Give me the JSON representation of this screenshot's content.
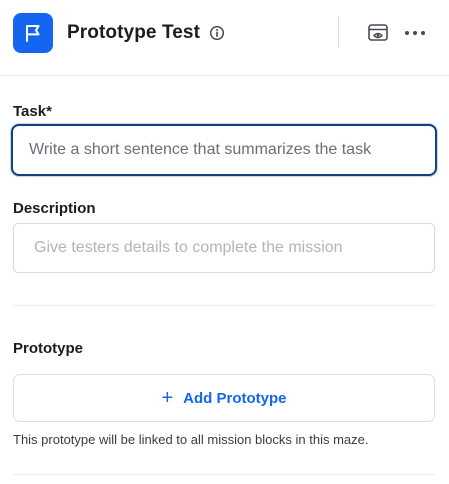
{
  "header": {
    "title": "Prototype Test",
    "icon": "flag-icon",
    "accent_color": "#1466f0",
    "actions": [
      "info-icon",
      "preview-icon",
      "more-icon"
    ]
  },
  "task": {
    "label": "Task*",
    "value": "",
    "placeholder": "Write a short sentence that summarizes the task"
  },
  "description": {
    "label": "Description",
    "value": "",
    "placeholder": "Give testers details to complete the mission"
  },
  "prototype": {
    "label": "Prototype",
    "add_button_icon": "+",
    "add_button_label": "Add Prototype",
    "helper_text": "This prototype will be linked to all mission blocks in this maze."
  },
  "colors": {
    "focus_border": "#154080",
    "link": "#1466f0"
  }
}
